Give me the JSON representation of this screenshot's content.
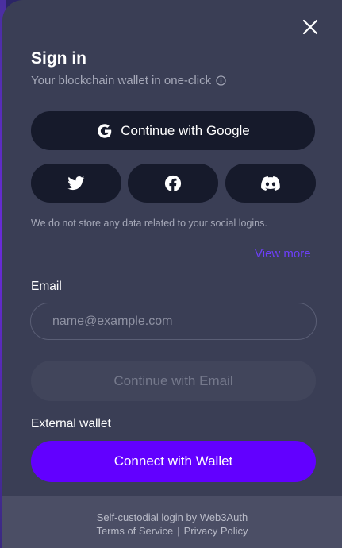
{
  "header": {
    "title": "Sign in",
    "subtitle": "Your blockchain wallet in one-click",
    "close_icon": "close-icon",
    "info_icon": "info-icon"
  },
  "social": {
    "google_label": "Continue with Google",
    "icons": [
      "google-icon",
      "twitter-icon",
      "facebook-icon",
      "discord-icon"
    ],
    "note": "We do not store any data related to your social logins.",
    "view_more": "View more"
  },
  "email": {
    "label": "Email",
    "placeholder": "name@example.com",
    "value": "",
    "continue_label": "Continue with Email"
  },
  "external": {
    "label": "External wallet",
    "button_label": "Connect with Wallet"
  },
  "footer": {
    "line1": "Self-custodial login by Web3Auth",
    "terms": "Terms of Service",
    "separator": "|",
    "privacy": "Privacy Policy"
  },
  "colors": {
    "modal_bg": "#3a3e55",
    "button_dark": "#161a2b",
    "accent": "#6200ff",
    "link": "#6d3ff8",
    "footer_bg": "#4b4e65"
  }
}
